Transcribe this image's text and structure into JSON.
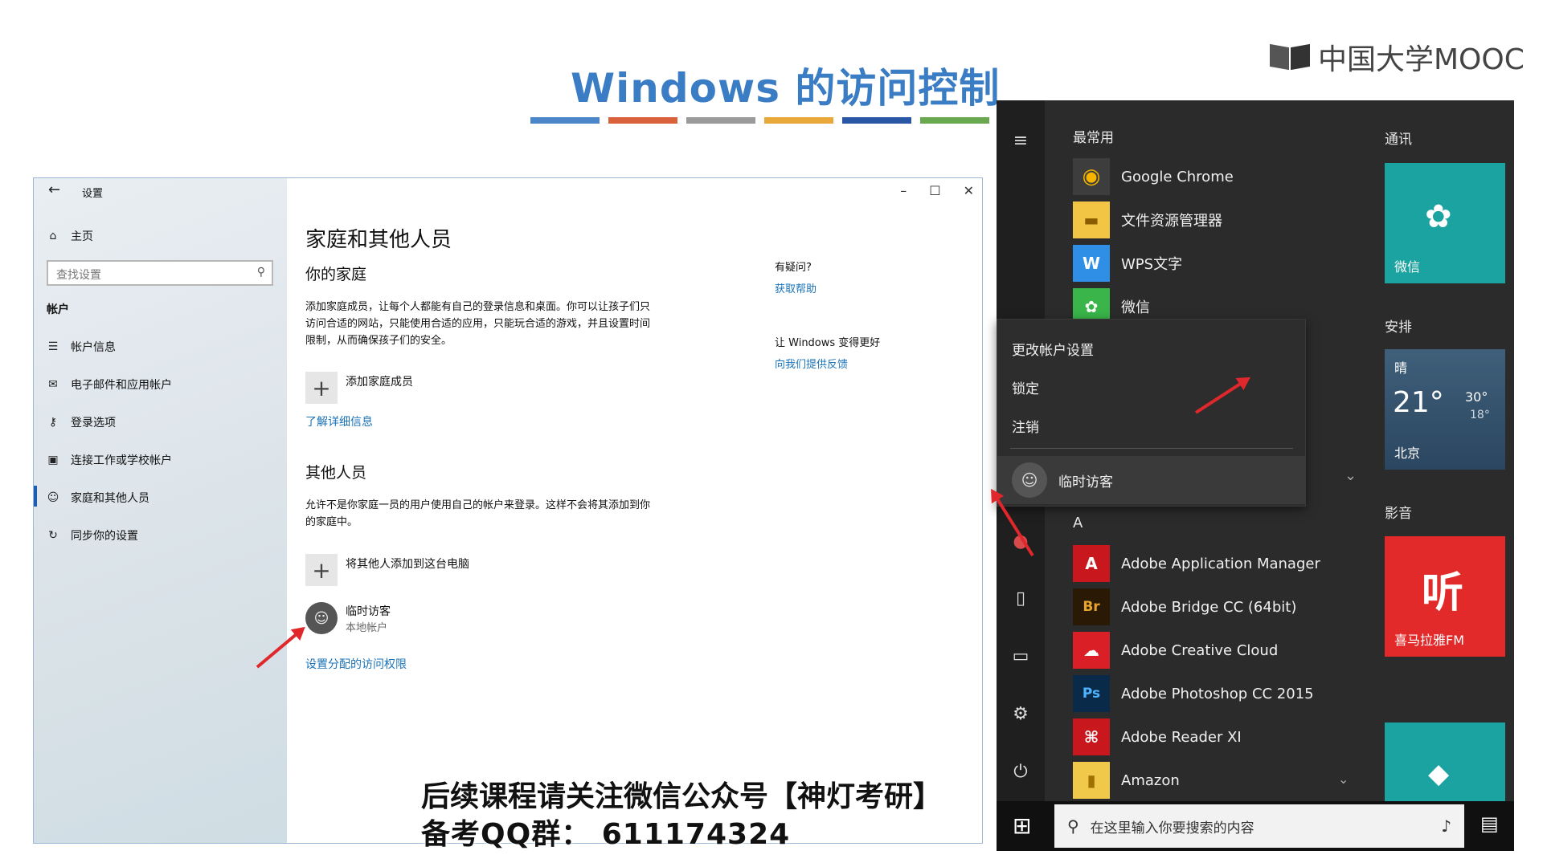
{
  "slide": {
    "title": "Windows 的访问控制",
    "logo_text": "中国大学MOOC",
    "stripes": [
      "#4a86c8",
      "#d9623c",
      "#9a9a9a",
      "#e8a93a",
      "#2a56a6",
      "#6aa84f"
    ]
  },
  "settings": {
    "window_title": "设置",
    "controls": {
      "minimize": "–",
      "maximize": "☐",
      "close": "✕"
    },
    "sidebar": {
      "home": "主页",
      "search_placeholder": "查找设置",
      "section": "帐户",
      "items": [
        {
          "label": "帐户信息",
          "icon": "person-card-icon"
        },
        {
          "label": "电子邮件和应用帐户",
          "icon": "mail-icon"
        },
        {
          "label": "登录选项",
          "icon": "key-icon"
        },
        {
          "label": "连接工作或学校帐户",
          "icon": "briefcase-icon"
        },
        {
          "label": "家庭和其他人员",
          "icon": "person-icon"
        },
        {
          "label": "同步你的设置",
          "icon": "sync-icon"
        }
      ]
    },
    "main": {
      "title": "家庭和其他人员",
      "family_heading": "你的家庭",
      "family_desc": "添加家庭成员，让每个人都能有自己的登录信息和桌面。你可以让孩子们只访问合适的网站，只能使用合适的应用，只能玩合适的游戏，并且设置时间限制，从而确保孩子们的安全。",
      "add_family": "添加家庭成员",
      "learn_more": "了解详细信息",
      "others_heading": "其他人员",
      "others_desc": "允许不是你家庭一员的用户使用自己的帐户来登录。这样不会将其添加到你的家庭中。",
      "add_other": "将其他人添加到这台电脑",
      "user_name": "临时访客",
      "user_type": "本地帐户",
      "assigned_access": "设置分配的访问权限"
    },
    "right": {
      "question": "有疑问?",
      "get_help": "获取帮助",
      "improve": "让 Windows 变得更好",
      "feedback": "向我们提供反馈"
    }
  },
  "start_menu": {
    "most_used": "最常用",
    "apps_top": [
      {
        "label": "Google Chrome",
        "icon": "chrome-icon",
        "color": "#2b2b2b",
        "glyph": "◉"
      },
      {
        "label": "文件资源管理器",
        "icon": "folder-icon",
        "color": "#f3c544",
        "glyph": "▬"
      },
      {
        "label": "WPS文字",
        "icon": "wps-icon",
        "color": "#2f8ee5",
        "glyph": "W"
      },
      {
        "label": "微信",
        "icon": "wechat-icon",
        "color": "#39b54a",
        "glyph": "✿"
      }
    ],
    "popup": {
      "change_settings": "更改帐户设置",
      "lock": "锁定",
      "sign_out": "注销",
      "account": "临时访客"
    },
    "letter": "A",
    "apps_a": [
      {
        "label": "Adobe Application Manager",
        "icon": "adobe-app-manager-icon",
        "color": "#c8171d",
        "glyph": "A"
      },
      {
        "label": "Adobe Bridge CC (64bit)",
        "icon": "adobe-bridge-icon",
        "color": "#2a1a05",
        "glyph": "Br"
      },
      {
        "label": "Adobe Creative Cloud",
        "icon": "creative-cloud-icon",
        "color": "#da1f26",
        "glyph": "☁"
      },
      {
        "label": "Adobe Photoshop CC 2015",
        "icon": "photoshop-icon",
        "color": "#0a2a4a",
        "glyph": "Ps"
      },
      {
        "label": "Adobe Reader XI",
        "icon": "adobe-reader-icon",
        "color": "#c8171d",
        "glyph": "⌘"
      },
      {
        "label": "Amazon",
        "icon": "amazon-icon",
        "color": "#f0c94a",
        "glyph": "▮"
      }
    ],
    "tiles": {
      "comm_head": "通讯",
      "wechat": "微信",
      "schedule_head": "安排",
      "weather_cond": "晴",
      "weather_temp": "21°",
      "weather_high": "30°",
      "weather_low": "18°",
      "weather_city": "北京",
      "media_head": "影音",
      "fm_glyph": "听",
      "fm_label": "喜马拉雅FM"
    },
    "taskbar": {
      "search_placeholder": "在这里输入你要搜索的内容"
    }
  },
  "caption": {
    "line1": "后续课程请关注微信公众号【神灯考研】",
    "line2": "备考QQ群：  611174324"
  }
}
